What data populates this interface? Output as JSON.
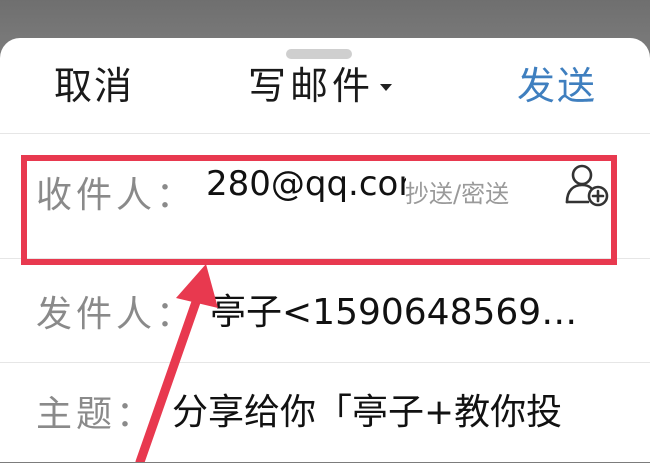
{
  "nav": {
    "cancel_label": "取消",
    "title": "写邮件",
    "send_label": "发送"
  },
  "compose": {
    "to": {
      "label": "收件人：",
      "value": "280@qq.com",
      "cc_bcc_label": "抄送/密送"
    },
    "from": {
      "label": "发件人：",
      "value": "亭子<1590648569@q…"
    },
    "subject": {
      "label": "主题：",
      "value": "分享给你「亭子+教你投"
    }
  },
  "colors": {
    "accent": "#3f7fbf",
    "highlight": "#e8394f"
  }
}
